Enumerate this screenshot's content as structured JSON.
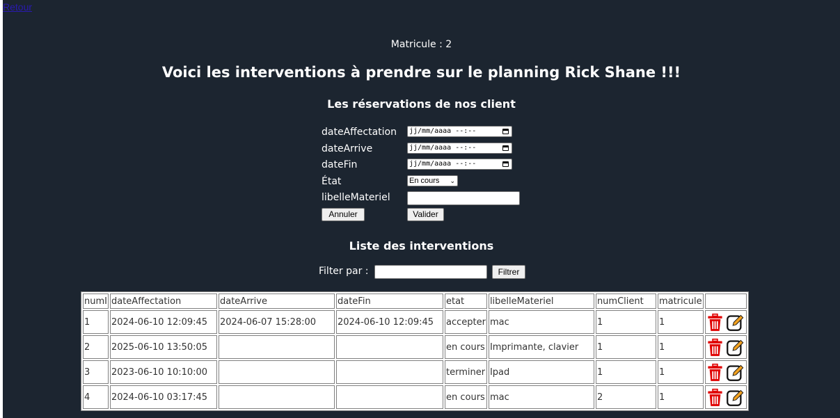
{
  "nav": {
    "back_label": "Retour"
  },
  "header": {
    "matricule": "Matricule : 2",
    "title": "Voici les interventions à prendre sur le planning Rick  Shane  !!!",
    "subtitle": "Les réservations de nos client"
  },
  "form": {
    "date_affectation_label": "dateAffectation",
    "date_arrive_label": "dateArrive",
    "date_fin_label": "dateFin",
    "etat_label": "État",
    "libelle_label": "libelleMateriel",
    "date_placeholder": "jj/mm/aaaa --:--",
    "etat_selected": "En cours",
    "cancel_label": "Annuler",
    "submit_label": "Valider"
  },
  "list": {
    "title": "Liste des interventions",
    "filter_label": "Filter par :",
    "filter_button": "Filtrer"
  },
  "table": {
    "columns": [
      "numI",
      "dateAffectation",
      "dateArrive",
      "dateFin",
      "etat",
      "libelleMateriel",
      "numClient",
      "matricule"
    ],
    "rows": [
      [
        "1",
        "2024-06-10 12:09:45",
        "2024-06-07 15:28:00",
        "2024-06-10 12:09:45",
        "accepter",
        "mac",
        "1",
        "1"
      ],
      [
        "2",
        "2025-06-10 13:50:05",
        "",
        "",
        "en cours",
        "Imprimante, clavier",
        "1",
        "1"
      ],
      [
        "3",
        "2023-06-10 10:10:00",
        "",
        "",
        "terminer",
        "Ipad",
        "1",
        "1"
      ],
      [
        "4",
        "2024-06-10 03:17:45",
        "",
        "",
        "en cours",
        "mac",
        "2",
        "1"
      ]
    ]
  },
  "colors": {
    "background": "#1c2530",
    "trash": "#e00000",
    "edit_accent": "#f0a020"
  },
  "icons": {
    "delete": "trash-icon",
    "edit": "edit-icon"
  }
}
